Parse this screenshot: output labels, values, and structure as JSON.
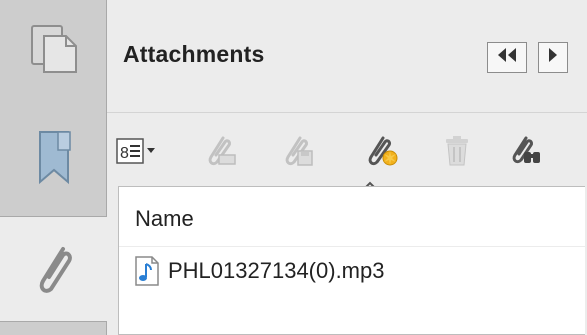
{
  "panel": {
    "title": "Attachments"
  },
  "nav": {
    "tabs": [
      {
        "icon": "pages-icon"
      },
      {
        "icon": "bookmark-icon"
      },
      {
        "icon": "paperclip-icon"
      }
    ]
  },
  "header_buttons": {
    "collapse_icon": "double-chevron-left-icon",
    "expand_icon": "chevron-right-icon"
  },
  "toolbar": {
    "items": [
      {
        "icon": "list-options-icon"
      },
      {
        "icon": "open-attachment-icon"
      },
      {
        "icon": "save-attachment-icon"
      },
      {
        "icon": "add-attachment-icon"
      },
      {
        "icon": "trash-icon"
      },
      {
        "icon": "search-attachments-icon"
      }
    ]
  },
  "table": {
    "columns": [
      "Name"
    ],
    "rows": [
      {
        "name": "PHL01327134(0).mp3",
        "icon": "music-file-icon"
      }
    ]
  },
  "colors": {
    "rail": "#cdcdcd",
    "panel": "#ececec",
    "list_bg": "#ffffff",
    "music_icon": "#2a7fd4",
    "add_accent": "#f2b11c"
  }
}
